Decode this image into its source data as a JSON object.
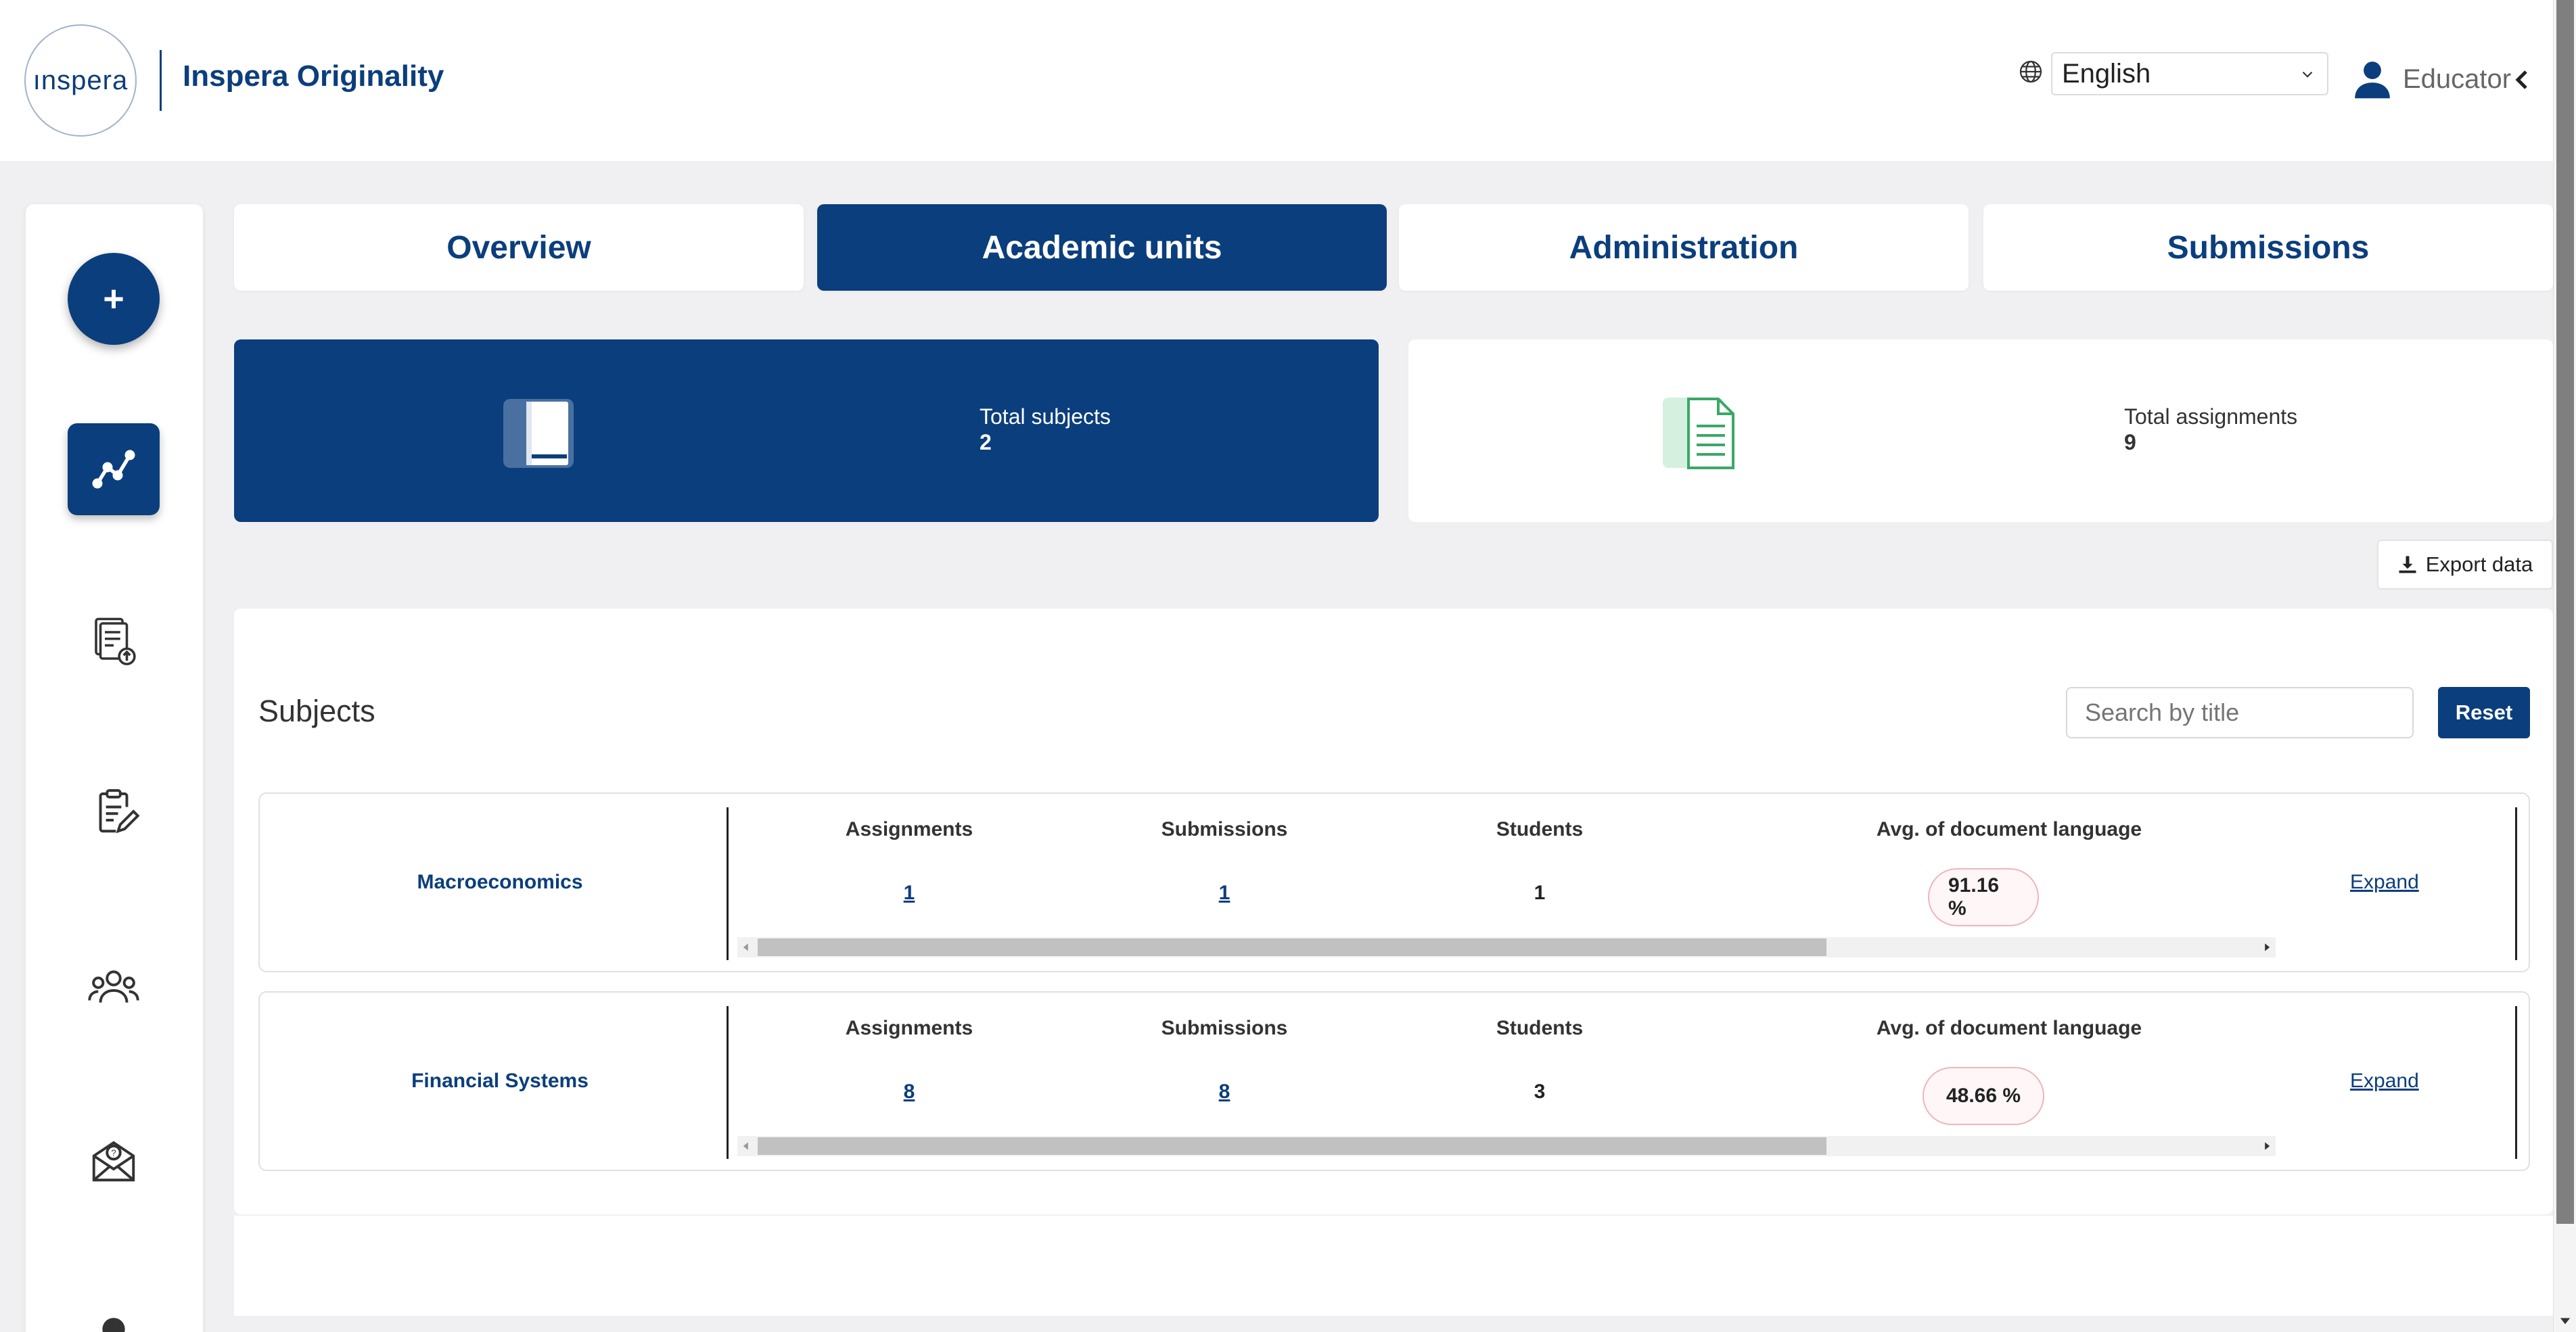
{
  "header": {
    "logo_text": "ınspera",
    "app_title": "Inspera Originality",
    "language": "English",
    "role": "Educator"
  },
  "tabs": [
    {
      "label": "Overview",
      "active": false
    },
    {
      "label": "Academic units",
      "active": true
    },
    {
      "label": "Administration",
      "active": false
    },
    {
      "label": "Submissions",
      "active": false
    }
  ],
  "rail": {
    "add_label": "+",
    "icons": [
      "analytics-icon",
      "document-upload-icon",
      "clipboard-edit-icon",
      "users-icon",
      "help-mail-icon",
      "profile-icon"
    ]
  },
  "stats": {
    "subjects_label": "Total subjects",
    "subjects_value": "2",
    "assignments_label": "Total assignments",
    "assignments_value": "9"
  },
  "export_label": "Export data",
  "subjects": {
    "title": "Subjects",
    "search_placeholder": "Search by title",
    "reset_label": "Reset",
    "columns": {
      "assignments": "Assignments",
      "submissions": "Submissions",
      "students": "Students",
      "avg_language": "Avg. of document language"
    },
    "expand_label": "Expand",
    "rows": [
      {
        "name": "Macroeconomics",
        "assignments": "1",
        "submissions": "1",
        "students": "1",
        "avg_language": "91.16 %"
      },
      {
        "name": "Financial Systems",
        "assignments": "8",
        "submissions": "8",
        "students": "3",
        "avg_language": "48.66 %"
      }
    ]
  },
  "colors": {
    "brand": "#0b3e7c",
    "background": "#f0f0f2",
    "badge_border": "#f0b4bc"
  }
}
